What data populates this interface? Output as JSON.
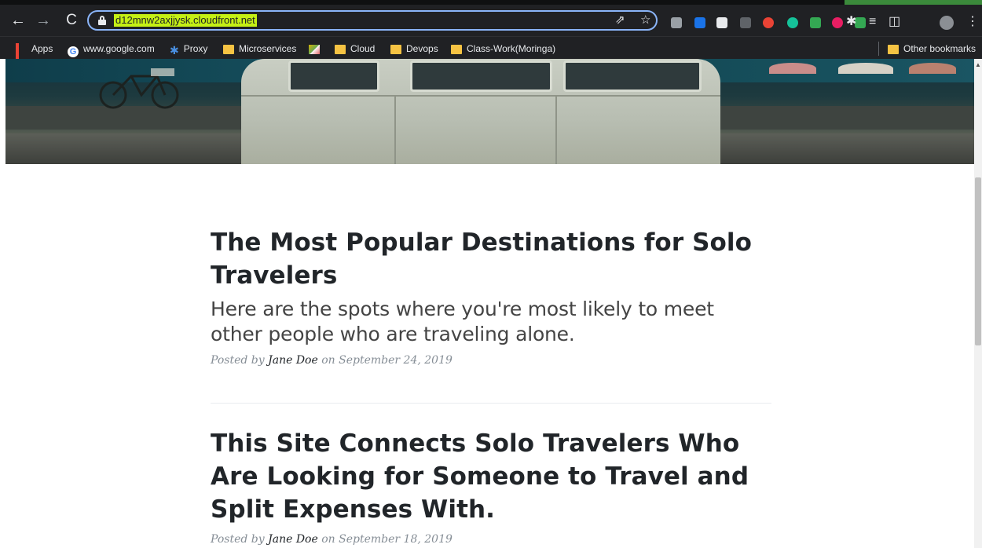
{
  "browser": {
    "url": "d12mnw2axjjysk.cloudfront.net",
    "nav": {
      "back": "←",
      "forward": "→",
      "reload": "C"
    },
    "omnibox_icons": {
      "share": "⇗",
      "star": "☆"
    },
    "menu_glyph": "⋮",
    "extensions": [
      {
        "name": "extension-1-icon",
        "color": "#9aa0a6"
      },
      {
        "name": "extension-2-icon",
        "color": "#1a73e8"
      },
      {
        "name": "extension-3-icon",
        "color": "#e8eaed"
      },
      {
        "name": "extension-4-icon",
        "color": "#5f6368"
      },
      {
        "name": "extension-5-icon",
        "color": "#ea4335"
      },
      {
        "name": "grammarly-icon",
        "color": "#15c39a"
      },
      {
        "name": "extension-7-icon",
        "color": "#34a853"
      },
      {
        "name": "extension-8-icon",
        "color": "#e91e63"
      },
      {
        "name": "extension-9-icon",
        "color": "#34a853"
      }
    ]
  },
  "bookmarks": {
    "items": [
      {
        "label": "Apps",
        "icon": "apps-grid-icon"
      },
      {
        "label": "www.google.com",
        "icon": "google-icon"
      },
      {
        "label": "Proxy",
        "icon": "gear-icon"
      },
      {
        "label": "Microservices",
        "icon": "folder-icon"
      },
      {
        "label": "",
        "icon": "image-bookmark-icon"
      },
      {
        "label": "Cloud",
        "icon": "folder-icon"
      },
      {
        "label": "Devops",
        "icon": "folder-icon"
      },
      {
        "label": "Class-Work(Moringa)",
        "icon": "folder-icon"
      }
    ],
    "other": "Other bookmarks"
  },
  "posts": [
    {
      "title": "The Most Popular Destinations for Solo Travelers",
      "subtitle": "Here are the spots where you're most likely to meet other people who are traveling alone.",
      "meta_prefix": "Posted by",
      "author": "Jane Doe",
      "meta_on": "on",
      "date": "September 24, 2019"
    },
    {
      "title": "This Site Connects Solo Travelers Who Are Looking for Someone to Travel and Split Expenses With.",
      "meta_prefix": "Posted by",
      "author": "Jane Doe",
      "meta_on": "on",
      "date": "September 18, 2019"
    }
  ]
}
